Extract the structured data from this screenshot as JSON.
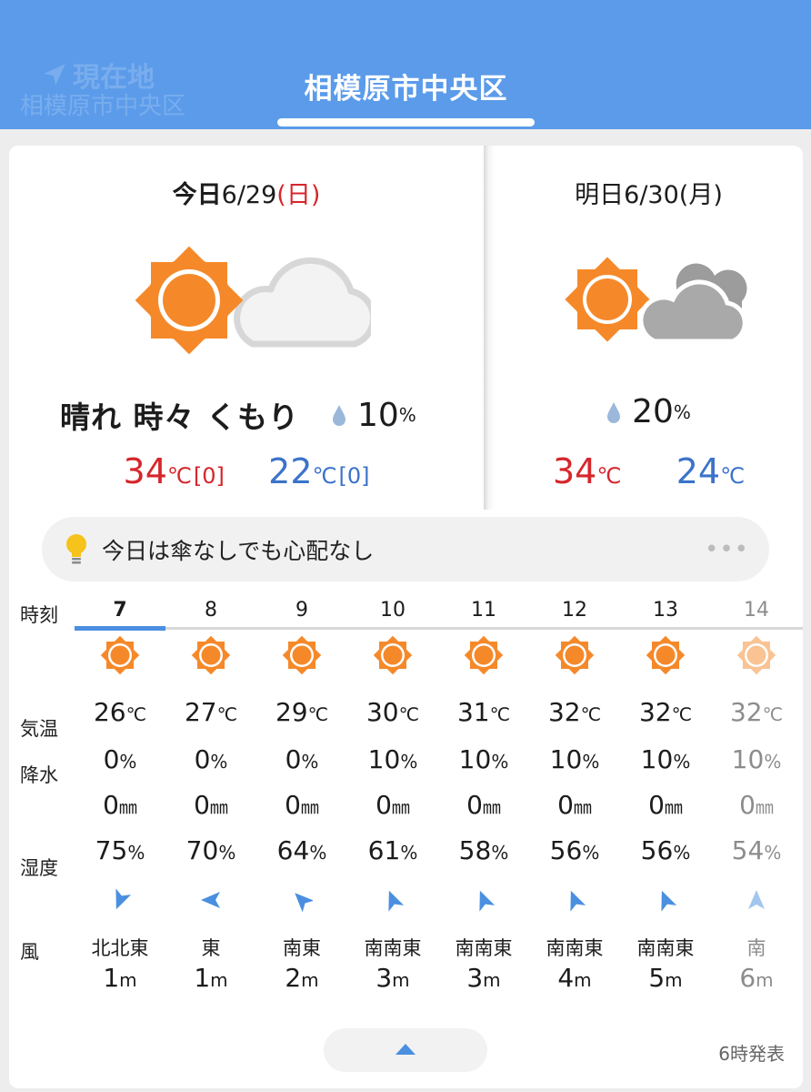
{
  "header": {
    "current_location_label": "現在地",
    "current_location_sub": "相模原市中央区",
    "active_tab": "相模原市中央区"
  },
  "today": {
    "date_label": "今日",
    "date": "6/29",
    "weekday": "(日)",
    "icon": "sun-with-cloud-icon",
    "condition": "晴れ 時々 くもり",
    "rain_chance": "10",
    "rain_unit": "%",
    "high": "34",
    "high_diff": "[0]",
    "low": "22",
    "low_diff": "[0]",
    "temp_unit": "℃"
  },
  "tomorrow": {
    "date_label": "明日",
    "date": "6/30",
    "weekday": "(月)",
    "icon": "sun-with-gray-cloud-icon",
    "rain_chance": "20",
    "rain_unit": "%",
    "high": "34",
    "low": "24",
    "temp_unit": "℃"
  },
  "advice": {
    "text": "今日は傘なしでも心配なし",
    "more": "•••"
  },
  "table": {
    "labels": {
      "time": "時刻",
      "temp": "気温",
      "precip": "降水",
      "humidity": "湿度",
      "wind": "風"
    },
    "units": {
      "temp": "℃",
      "pct": "%",
      "mm": "㎜",
      "m": "m"
    },
    "hours": [
      {
        "hour": "7",
        "temp": "26",
        "precip": "0",
        "mm": "0",
        "humidity": "75",
        "wind_dir": "北北東",
        "wind_speed": "1"
      },
      {
        "hour": "8",
        "temp": "27",
        "precip": "0",
        "mm": "0",
        "humidity": "70",
        "wind_dir": "東",
        "wind_speed": "1"
      },
      {
        "hour": "9",
        "temp": "29",
        "precip": "0",
        "mm": "0",
        "humidity": "64",
        "wind_dir": "南東",
        "wind_speed": "2"
      },
      {
        "hour": "10",
        "temp": "30",
        "precip": "10",
        "mm": "0",
        "humidity": "61",
        "wind_dir": "南南東",
        "wind_speed": "3"
      },
      {
        "hour": "11",
        "temp": "31",
        "precip": "10",
        "mm": "0",
        "humidity": "58",
        "wind_dir": "南南東",
        "wind_speed": "3"
      },
      {
        "hour": "12",
        "temp": "32",
        "precip": "10",
        "mm": "0",
        "humidity": "56",
        "wind_dir": "南南東",
        "wind_speed": "4"
      },
      {
        "hour": "13",
        "temp": "32",
        "precip": "10",
        "mm": "0",
        "humidity": "56",
        "wind_dir": "南南東",
        "wind_speed": "5"
      },
      {
        "hour": "14",
        "temp": "32",
        "precip": "10",
        "mm": "0",
        "humidity": "54",
        "wind_dir": "南",
        "wind_speed": "6"
      }
    ]
  },
  "footer": {
    "issued": "6時発表"
  },
  "colors": {
    "header_bg": "#5b9bea",
    "sun": "#f5892a",
    "high": "#d6262b",
    "low": "#3b73c9",
    "accent": "#4a8fe0"
  }
}
